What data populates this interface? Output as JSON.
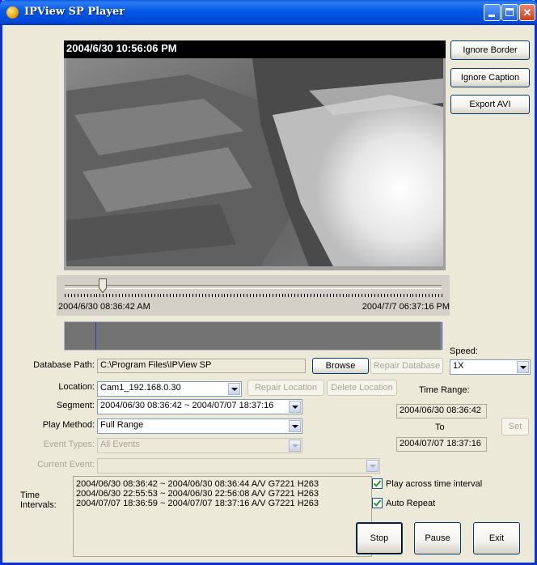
{
  "window": {
    "title": "IPView SP Player"
  },
  "video": {
    "timestamp": "2004/6/30 10:56:06 PM"
  },
  "side_buttons": {
    "ignore_border": "Ignore Border",
    "ignore_caption": "Ignore Caption",
    "export_avi": "Export AVI"
  },
  "slider": {
    "start_label": "2004/6/30 08:36:42 AM",
    "end_label": "2004/7/7 06:37:16 PM",
    "position_fraction": 0.1
  },
  "database": {
    "label": "Database Path:",
    "value": "C:\\Program Files\\IPView SP",
    "browse": "Browse",
    "repair": "Repair Database"
  },
  "speed": {
    "label": "Speed:",
    "value": "1X"
  },
  "location": {
    "label": "Location:",
    "value": "Cam1_192.168.0.30",
    "repair": "Repair Location",
    "delete": "Delete Location"
  },
  "time_range": {
    "label": "Time Range:",
    "from": "2004/06/30 08:36:42",
    "to_label": "To",
    "to": "2004/07/07 18:37:16",
    "set": "Set"
  },
  "segment": {
    "label": "Segment:",
    "value": "2004/06/30 08:36:42 ~ 2004/07/07 18:37:16"
  },
  "play_method": {
    "label": "Play Method:",
    "value": "Full Range"
  },
  "event_types": {
    "label": "Event Types:",
    "value": "All Events"
  },
  "current_event": {
    "label": "Current Event:",
    "value": ""
  },
  "time_intervals": {
    "label_line1": "Time",
    "label_line2": "Intervals:",
    "items": [
      "2004/06/30 08:36:42 ~ 2004/06/30 08:36:44 A/V G7221 H263",
      "2004/06/30 22:55:53 ~ 2004/06/30 22:56:08 A/V G7221 H263",
      "2004/07/07 18:36:59 ~ 2004/07/07 18:37:16 A/V G7221 H263"
    ]
  },
  "options": {
    "play_across": "Play across time interval",
    "play_across_checked": true,
    "auto_repeat": "Auto Repeat",
    "auto_repeat_checked": true
  },
  "controls": {
    "stop": "Stop",
    "pause": "Pause",
    "exit": "Exit"
  }
}
